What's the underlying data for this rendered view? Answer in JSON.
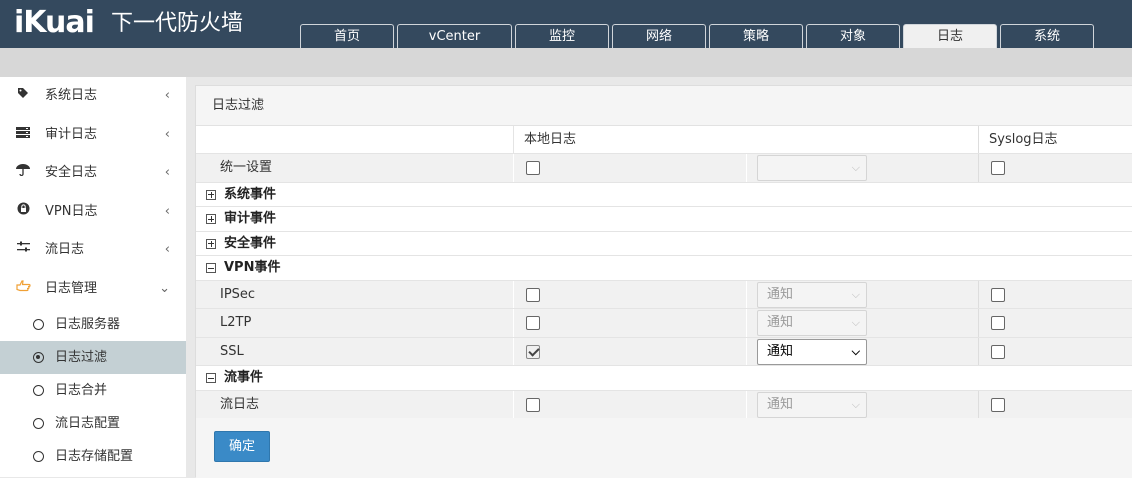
{
  "brand": {
    "logo": "iKuai",
    "product": "下一代防火墙"
  },
  "tabs": [
    {
      "label": "首页"
    },
    {
      "label": "vCenter"
    },
    {
      "label": "监控"
    },
    {
      "label": "网络"
    },
    {
      "label": "策略"
    },
    {
      "label": "对象"
    },
    {
      "label": "日志",
      "active": true
    },
    {
      "label": "系统"
    }
  ],
  "sidebar": {
    "items": [
      {
        "label": "系统日志",
        "icon": "tag-icon"
      },
      {
        "label": "审计日志",
        "icon": "server-icon"
      },
      {
        "label": "安全日志",
        "icon": "umbrella-icon"
      },
      {
        "label": "VPN日志",
        "icon": "lock-icon"
      },
      {
        "label": "流日志",
        "icon": "sliders-icon"
      },
      {
        "label": "日志管理",
        "icon": "hand-pointer-icon",
        "open": true
      }
    ],
    "subitems": [
      {
        "label": "日志服务器"
      },
      {
        "label": "日志过滤",
        "active": true
      },
      {
        "label": "日志合并"
      },
      {
        "label": "流日志配置"
      },
      {
        "label": "日志存储配置"
      }
    ]
  },
  "panel": {
    "title": "日志过滤",
    "columns": {
      "local": "本地日志",
      "syslog": "Syslog日志"
    },
    "unified": {
      "label": "统一设置",
      "local_checked": false,
      "level": "",
      "syslog_checked": false
    },
    "groups": {
      "system": "系统事件",
      "audit": "审计事件",
      "security": "安全事件",
      "vpn": "VPN事件",
      "flow": "流事件"
    },
    "vpn_rows": [
      {
        "label": "IPSec",
        "local_checked": false,
        "level": "通知",
        "syslog_checked": false
      },
      {
        "label": "L2TP",
        "local_checked": false,
        "level": "通知",
        "syslog_checked": false
      },
      {
        "label": "SSL",
        "local_checked": true,
        "level": "通知",
        "syslog_checked": false
      }
    ],
    "flow_rows": [
      {
        "label": "流日志",
        "local_checked": false,
        "level": "通知",
        "syslog_checked": false
      }
    ],
    "confirm_label": "确定"
  }
}
